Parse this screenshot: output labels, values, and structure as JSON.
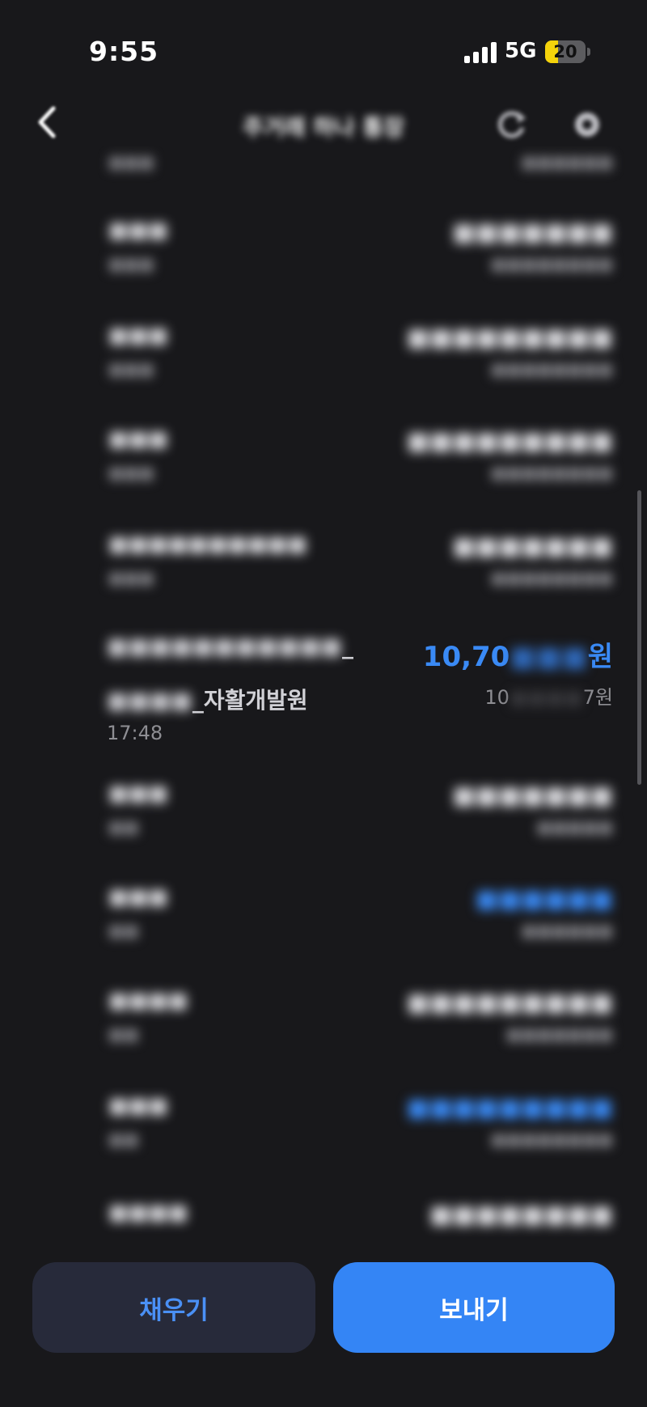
{
  "status": {
    "time": "9:55",
    "network": "5G",
    "battery": "20",
    "battery_level": 0.2
  },
  "nav": {
    "title": "주거래 하나 통장"
  },
  "focused_transaction": {
    "name_line1": "_",
    "name_line2": "_자활개발원",
    "time": "17:48",
    "amount_visible_prefix": "10,70",
    "amount_visible_suffix": "원",
    "balance_visible_prefix": "10",
    "balance_visible_suffix": "7원"
  },
  "buttons": {
    "fill_label": "채우기",
    "send_label": "보내기"
  },
  "colors": {
    "accent": "#3485f5",
    "background": "#18181b",
    "fill_button_bg": "#272a3a"
  }
}
